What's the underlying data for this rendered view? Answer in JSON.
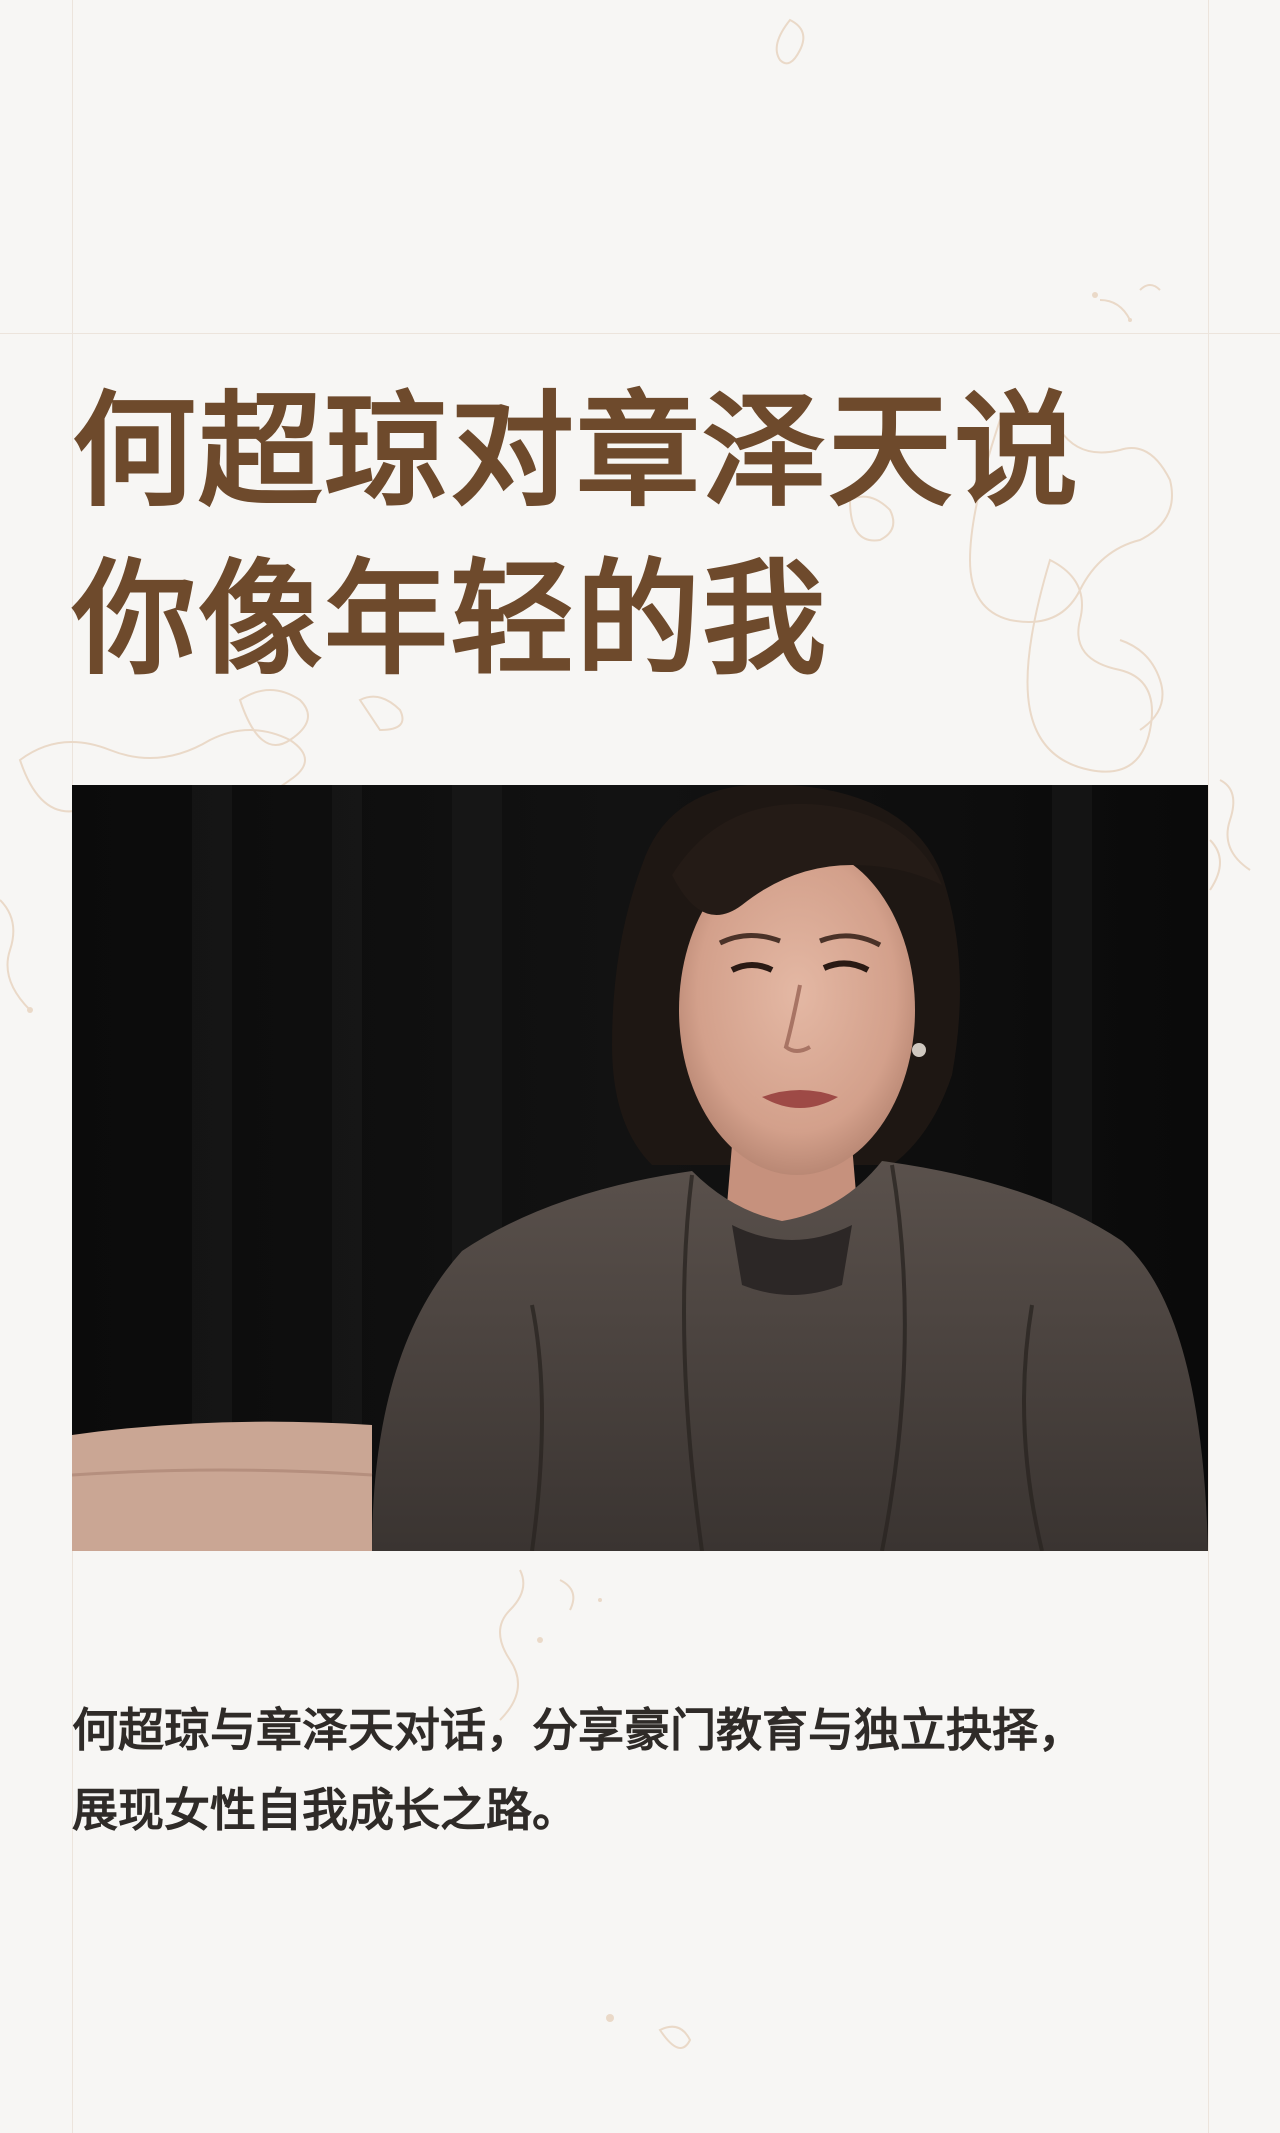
{
  "headline": {
    "line1": "何超琼对章泽天说",
    "line2": "你像年轻的我"
  },
  "summary": {
    "line1": "何超琼与章泽天对话，分享豪门教育与独立抉择，",
    "line2": "展现女性自我成长之路。"
  },
  "colors": {
    "background": "#f7f6f4",
    "headline": "#6e4a2c",
    "body_text": "#2f2b28",
    "decoration": "#ead9c8"
  }
}
